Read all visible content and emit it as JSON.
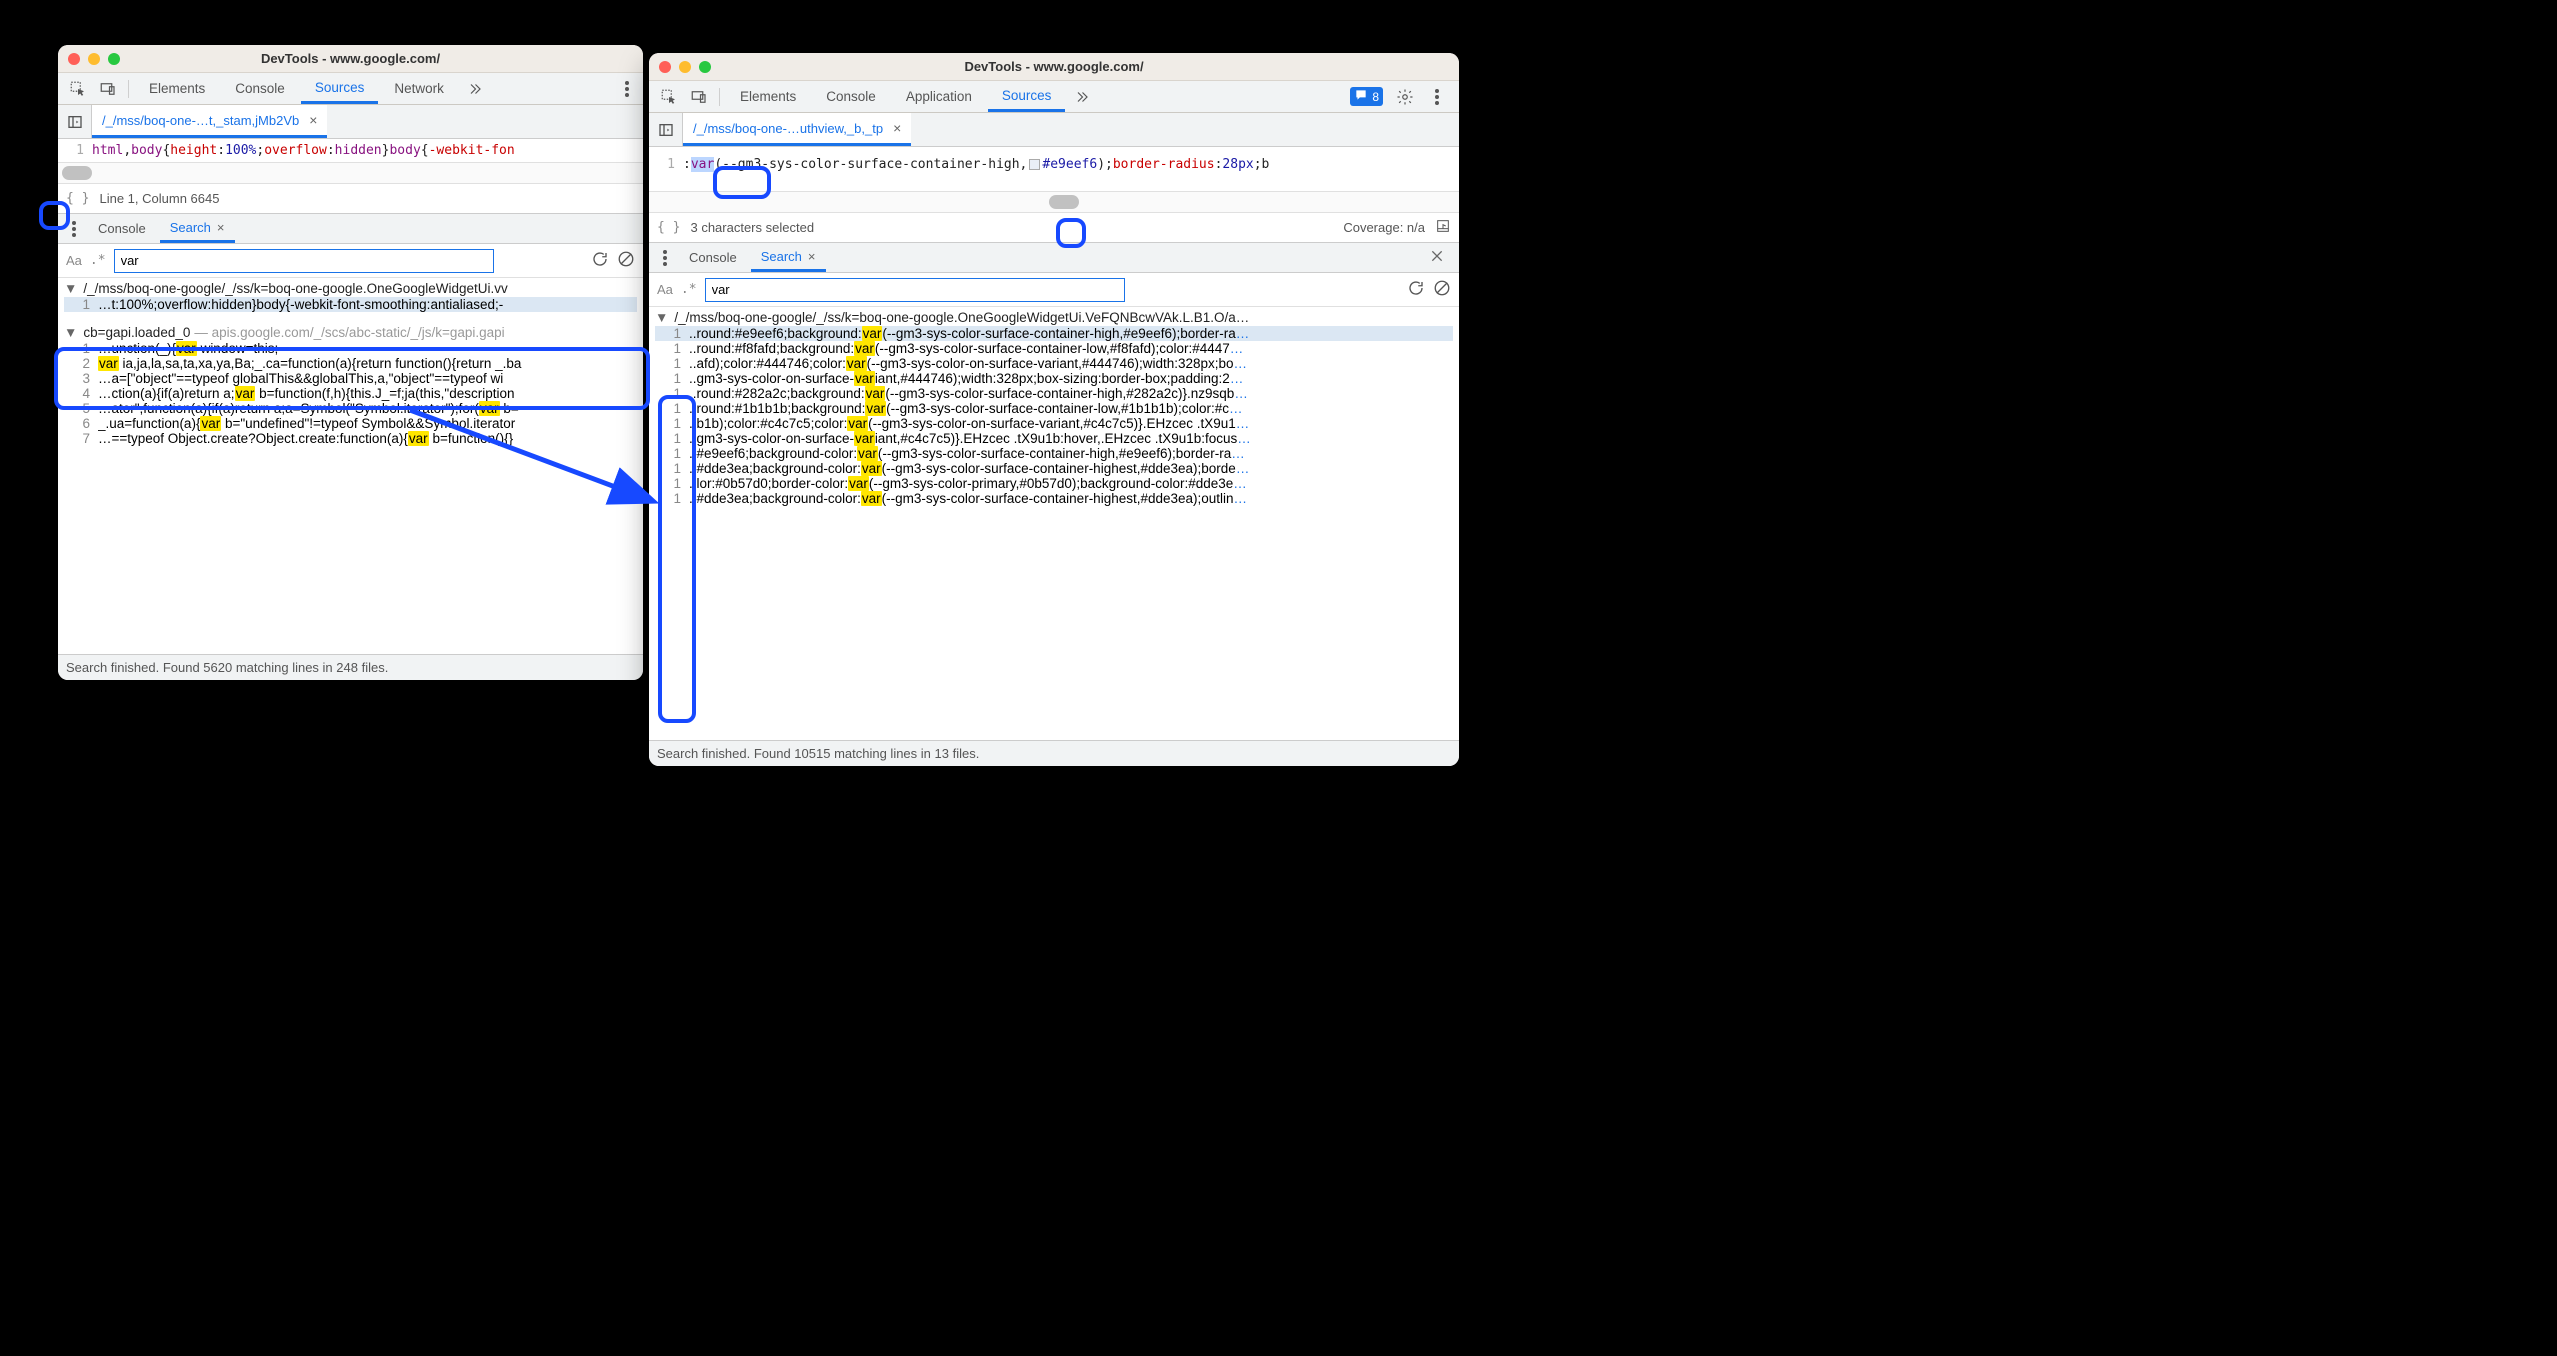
{
  "left": {
    "title": "DevTools - www.google.com/",
    "tabs": {
      "elements": "Elements",
      "console": "Console",
      "sources": "Sources",
      "network": "Network"
    },
    "filetab": "/_/mss/boq-one-…t,_stam,jMb2Vb",
    "code": {
      "line_no": "1",
      "seg1": "html",
      "seg2": ",",
      "seg3": "body",
      "seg4": "{",
      "seg5": "height",
      "seg6": ":",
      "seg7": "100%",
      "seg8": ";",
      "seg9": "overflow",
      "seg10": ":",
      "seg11": "hidden",
      "seg12": "}",
      "seg13": "body",
      "seg14": "{",
      "seg15": "-webkit-fon"
    },
    "status": "Line 1, Column 6645",
    "drawer": {
      "console": "Console",
      "search": "Search"
    },
    "search_value": "var",
    "results": {
      "g1_path": "/_/mss/boq-one-google/_/ss/k=boq-one-google.OneGoogleWidgetUi.vv",
      "g1_row1": {
        "ln": "1",
        "text": "…t:100%;overflow:hidden}body{-webkit-font-smoothing:antialiased;-"
      },
      "g2_head_name": "cb=gapi.loaded_0",
      "g2_head_domain": " — apis.google.com/_/scs/abc-static/_/js/k=gapi.gapi",
      "g2_rows": [
        {
          "ln": "1",
          "pre": "…unction(_){",
          "hl": "var",
          "post": " window=this;"
        },
        {
          "ln": "2",
          "pre": "",
          "hl": "var",
          "post": " ia,ja,la,sa,ta,xa,ya,Ba;_.ca=function(a){return function(){return _.ba"
        },
        {
          "ln": "3",
          "pre": "…a=[\"object\"==typeof globalThis&&globalThis,a,\"object\"==typeof wi",
          "hl": "",
          "post": ""
        },
        {
          "ln": "4",
          "pre": "…ction(a){if(a)return a;",
          "hl": "var",
          "post": " b=function(f,h){this.J_=f;ja(this,\"description"
        },
        {
          "ln": "5",
          "pre": "…ator\",function(a){if(a)return a;a=Symbol(\"Symbol.iterator\");for(",
          "hl": "var",
          "post": " b="
        },
        {
          "ln": "6",
          "pre": "_.ua=function(a){",
          "hl": "var",
          "post": " b=\"undefined\"!=typeof Symbol&&Symbol.iterator"
        },
        {
          "ln": "7",
          "pre": "…==typeof Object.create?Object.create:function(a){",
          "hl": "var",
          "post": " b=function(){}"
        }
      ]
    },
    "footer": "Search finished.  Found 5620 matching lines in 248 files."
  },
  "right": {
    "title": "DevTools - www.google.com/",
    "tabs": {
      "elements": "Elements",
      "console": "Console",
      "application": "Application",
      "sources": "Sources"
    },
    "issues_badge": "8",
    "filetab": "/_/mss/boq-one-…uthview,_b,_tp",
    "code": {
      "line_no": "1",
      "pre": ":",
      "var": "var",
      "open": "(",
      "arg": "--gm3-sys-color-surface-container-high,",
      "hex": "#e9eef6",
      "mid": ");",
      "prop": "border-radius",
      "colon": ":",
      "val": "28px",
      "semi": ";b"
    },
    "status_left": "3 characters selected",
    "coverage": "Coverage: n/a",
    "drawer": {
      "console": "Console",
      "search": "Search"
    },
    "search_value": "var",
    "results": {
      "g1_path": "/_/mss/boq-one-google/_/ss/k=boq-one-google.OneGoogleWidgetUi.VeFQNBcwVAk.L.B1.O/a…",
      "rows": [
        {
          "ln": "1",
          "pre": "..round:#e9eef6;background:",
          "hl": "var",
          "post": "(--gm3-sys-color-surface-container-high,#e9eef6);border-ra",
          "e": "…"
        },
        {
          "ln": "1",
          "pre": "..round:#f8fafd;background:",
          "hl": "var",
          "post": "(--gm3-sys-color-surface-container-low,#f8fafd);color:#4447",
          "e": "…"
        },
        {
          "ln": "1",
          "pre": "..afd);color:#444746;color:",
          "hl": "var",
          "post": "(--gm3-sys-color-on-surface-variant,#444746);width:328px;bo",
          "e": "…"
        },
        {
          "ln": "1",
          "pre": "..gm3-sys-color-on-surface-",
          "hl": "var",
          "post": "iant,#444746);width:328px;box-sizing:border-box;padding:2",
          "e": "…"
        },
        {
          "ln": "1",
          "pre": "..round:#282a2c;background:",
          "hl": "var",
          "post": "(--gm3-sys-color-surface-container-high,#282a2c)}.nz9sqb",
          "e": "…"
        },
        {
          "ln": "1",
          "pre": "..round:#1b1b1b;background:",
          "hl": "var",
          "post": "(--gm3-sys-color-surface-container-low,#1b1b1b);color:#c",
          "e": "…"
        },
        {
          "ln": "1",
          "pre": "..b1b);color:#c4c7c5;color:",
          "hl": "var",
          "post": "(--gm3-sys-color-on-surface-variant,#c4c7c5)}.EHzcec .tX9u1",
          "e": "…"
        },
        {
          "ln": "1",
          "pre": "..gm3-sys-color-on-surface-",
          "hl": "var",
          "post": "iant,#c4c7c5)}.EHzcec .tX9u1b:hover,.EHzcec .tX9u1b:focus",
          "e": "…"
        },
        {
          "ln": "1",
          "pre": "..#e9eef6;background-color:",
          "hl": "var",
          "post": "(--gm3-sys-color-surface-container-high,#e9eef6);border-ra",
          "e": "…"
        },
        {
          "ln": "1",
          "pre": "..#dde3ea;background-color:",
          "hl": "var",
          "post": "(--gm3-sys-color-surface-container-highest,#dde3ea);borde",
          "e": "…"
        },
        {
          "ln": "1",
          "pre": "..lor:#0b57d0;border-color:",
          "hl": "var",
          "post": "(--gm3-sys-color-primary,#0b57d0);background-color:#dde3e",
          "e": "…"
        },
        {
          "ln": "1",
          "pre": "..#dde3ea;background-color:",
          "hl": "var",
          "post": "(--gm3-sys-color-surface-container-highest,#dde3ea);outlin",
          "e": "…"
        }
      ]
    },
    "footer": "Search finished.  Found 10515 matching lines in 13 files."
  }
}
